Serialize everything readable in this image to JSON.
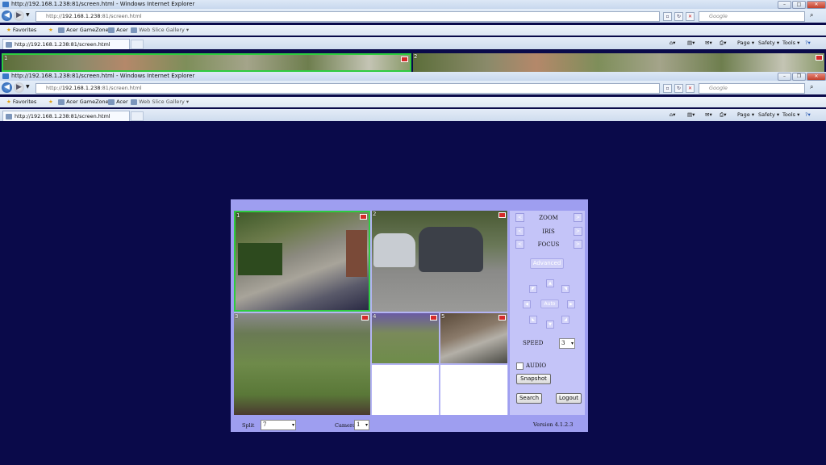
{
  "window": {
    "title": "http://192.168.1.238:81/screen.html - Windows Internet Explorer",
    "address_host": "192.168.1.238",
    "address_prefix": "http://",
    "address_suffix": ":81/screen.html",
    "search_placeholder": "Google",
    "tab_label": "http://192.168.1.238:81/screen.html"
  },
  "favorites": {
    "favorites_label": "Favorites",
    "items": [
      "Acer GameZone",
      "Acer",
      "Web Slice Gallery"
    ]
  },
  "command_bar": {
    "page": "Page",
    "safety": "Safety",
    "tools": "Tools",
    "help": "?"
  },
  "thumbs": {
    "n1": "1",
    "n2": "2"
  },
  "cameras": [
    {
      "number": "1",
      "selected": true
    },
    {
      "number": "2",
      "selected": false
    },
    {
      "number": "3",
      "selected": false
    },
    {
      "number": "4",
      "selected": false
    },
    {
      "number": "5",
      "selected": false
    }
  ],
  "ptz": {
    "zoom": "ZOOM",
    "iris": "IRIS",
    "focus": "FOCUS",
    "advanced": "Advanced",
    "auto": "Auto",
    "speed_label": "SPEED",
    "speed_value": "3",
    "audio": "AUDIO",
    "snapshot": "Snapshot",
    "search": "Search",
    "logout": "Logout",
    "left_arrow": "<",
    "right_arrow": ">"
  },
  "footer": {
    "split_label": "Split",
    "split_value": "7",
    "camera_label": "Camera",
    "camera_value": "1",
    "version": "Version 4.1.2.3"
  },
  "colors": {
    "desktop_bg": "#0a0a4a",
    "panel_bg": "#9e9ef0",
    "selected_border": "#2ecc40"
  }
}
